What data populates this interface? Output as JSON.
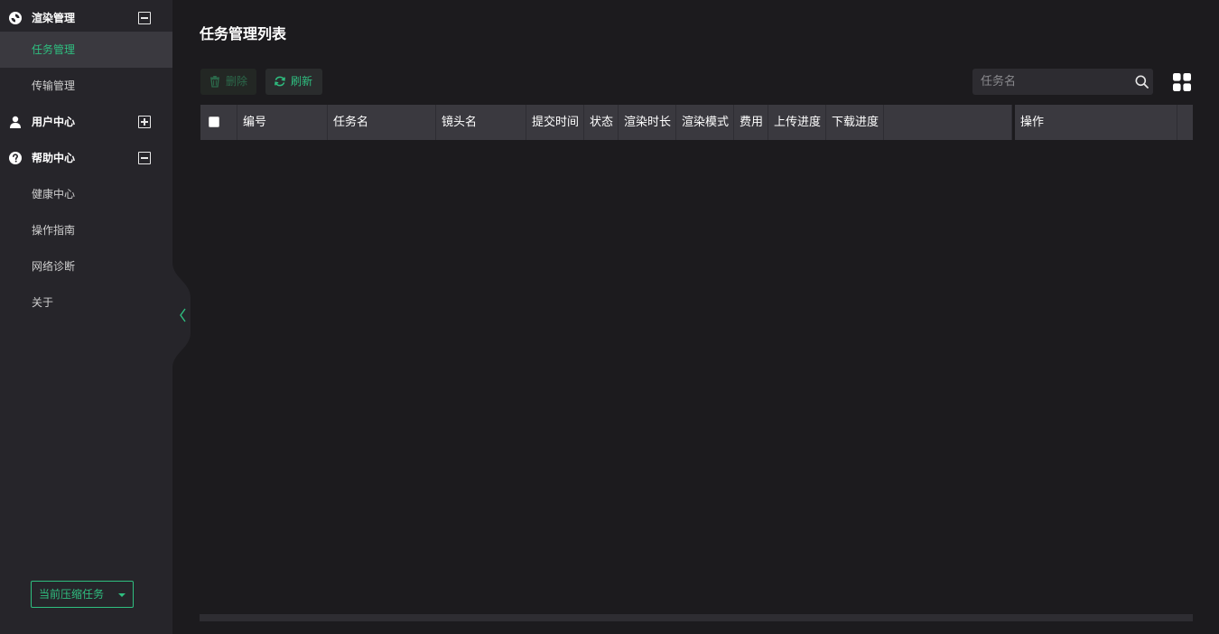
{
  "sidebar": {
    "groups": [
      {
        "label": "渲染管理",
        "icon": "render-logo-icon",
        "state": "expanded",
        "items": [
          {
            "label": "任务管理",
            "active": true
          },
          {
            "label": "传输管理",
            "active": false
          }
        ]
      },
      {
        "label": "用户中心",
        "icon": "user-icon",
        "state": "collapsed",
        "items": []
      },
      {
        "label": "帮助中心",
        "icon": "help-circle-icon",
        "state": "expanded",
        "items": [
          {
            "label": "健康中心"
          },
          {
            "label": "操作指南"
          },
          {
            "label": "网络诊断"
          },
          {
            "label": "关于"
          }
        ]
      }
    ],
    "compress_button": "当前压缩任务"
  },
  "main": {
    "title": "任务管理列表",
    "toolbar": {
      "delete_label": "删除",
      "refresh_label": "刷新"
    },
    "search": {
      "placeholder": "任务名",
      "value": ""
    },
    "table": {
      "columns": [
        "编号",
        "任务名",
        "镜头名",
        "提交时间",
        "状态",
        "渲染时长",
        "渲染模式",
        "费用",
        "上传进度",
        "下载进度",
        "",
        "操作"
      ],
      "rows": []
    }
  },
  "colors": {
    "accent": "#2fbf80",
    "sidebar_bg": "#26252a",
    "main_bg": "#1c1b1e",
    "header_bg": "#3a393f"
  }
}
